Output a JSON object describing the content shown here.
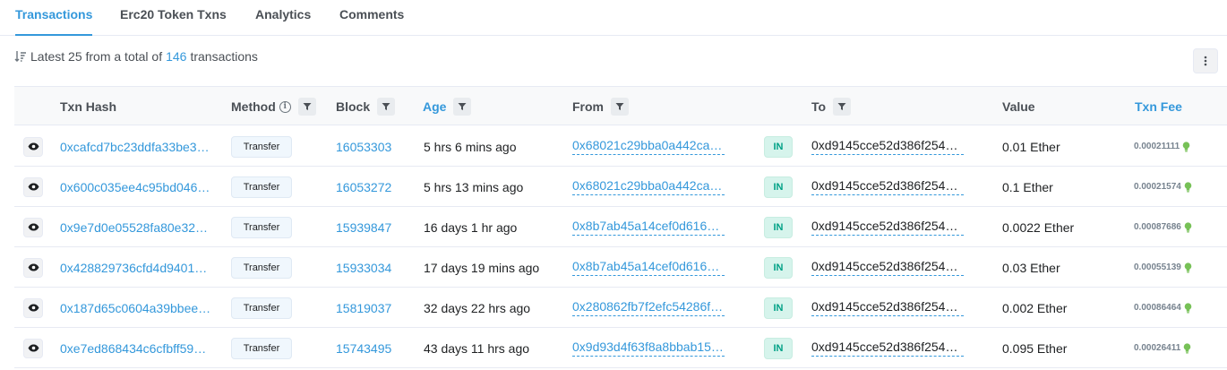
{
  "tabs": [
    {
      "label": "Transactions",
      "active": true
    },
    {
      "label": "Erc20 Token Txns"
    },
    {
      "label": "Analytics"
    },
    {
      "label": "Comments"
    }
  ],
  "summary": {
    "prefix": "Latest 25 from a total of",
    "count": "146",
    "suffix": "transactions"
  },
  "columns": {
    "txn_hash": "Txn Hash",
    "method": "Method",
    "block": "Block",
    "age": "Age",
    "from": "From",
    "to": "To",
    "value": "Value",
    "txn_fee": "Txn Fee"
  },
  "colors": {
    "accent": "#3498db",
    "in_badge_bg": "#d6f4ec",
    "in_badge_text": "#00a186",
    "fee_icon": "#77c157"
  },
  "icons": {
    "sort": "sort-descending-icon",
    "filter": "funnel-icon",
    "info": "info-circle-icon",
    "view": "eye-icon",
    "more": "vertical-ellipsis-icon",
    "fee": "lightbulb-icon"
  },
  "rows": [
    {
      "hash": "0xcafcd7bc23ddfa33be3…",
      "method": "Transfer",
      "block": "16053303",
      "age": "5 hrs 6 mins ago",
      "from": "0x68021c29bba0a442ca…",
      "direction": "IN",
      "to": "0xd9145cce52d386f254…",
      "value": "0.01 Ether",
      "fee": "0.00021111"
    },
    {
      "hash": "0x600c035ee4c95bd046…",
      "method": "Transfer",
      "block": "16053272",
      "age": "5 hrs 13 mins ago",
      "from": "0x68021c29bba0a442ca…",
      "direction": "IN",
      "to": "0xd9145cce52d386f254…",
      "value": "0.1 Ether",
      "fee": "0.00021574"
    },
    {
      "hash": "0x9e7d0e05528fa80e32…",
      "method": "Transfer",
      "block": "15939847",
      "age": "16 days 1 hr ago",
      "from": "0x8b7ab45a14cef0d616…",
      "direction": "IN",
      "to": "0xd9145cce52d386f254…",
      "value": "0.0022 Ether",
      "fee": "0.00087686"
    },
    {
      "hash": "0x428829736cfd4d9401…",
      "method": "Transfer",
      "block": "15933034",
      "age": "17 days 19 mins ago",
      "from": "0x8b7ab45a14cef0d616…",
      "direction": "IN",
      "to": "0xd9145cce52d386f254…",
      "value": "0.03 Ether",
      "fee": "0.00055139"
    },
    {
      "hash": "0x187d65c0604a39bbee…",
      "method": "Transfer",
      "block": "15819037",
      "age": "32 days 22 hrs ago",
      "from": "0x280862fb7f2efc54286f…",
      "direction": "IN",
      "to": "0xd9145cce52d386f254…",
      "value": "0.002 Ether",
      "fee": "0.00086464"
    },
    {
      "hash": "0xe7ed868434c6cfbff599…",
      "method": "Transfer",
      "block": "15743495",
      "age": "43 days 11 hrs ago",
      "from": "0x9d93d4f63f8a8bbab15…",
      "direction": "IN",
      "to": "0xd9145cce52d386f254…",
      "value": "0.095 Ether",
      "fee": "0.00026411"
    }
  ]
}
